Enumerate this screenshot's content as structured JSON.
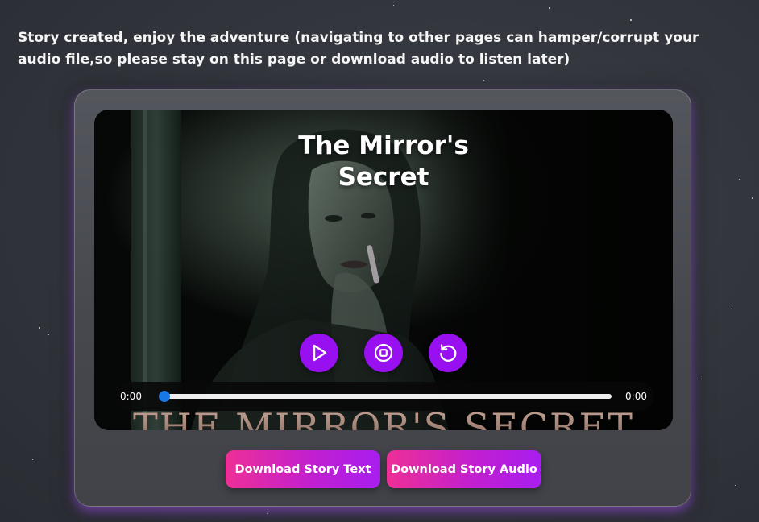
{
  "notice": {
    "text": "Story created, enjoy the adventure (navigating to other pages can hamper/corrupt your audio file,so please stay on this page or download audio to listen later)"
  },
  "story": {
    "title": "The Mirror's Secret",
    "cover_caption": "THE MIRROR'S SECRET"
  },
  "player": {
    "controls": [
      {
        "name": "play-button",
        "icon": "play-icon"
      },
      {
        "name": "stop-button",
        "icon": "stop-icon"
      },
      {
        "name": "restart-button",
        "icon": "restart-icon"
      }
    ],
    "current_time": "0:00",
    "duration": "0:00",
    "progress": 0
  },
  "actions": {
    "download_text_label": "Download Story Text",
    "download_audio_label": "Download Story Audio"
  },
  "colors": {
    "accent_purple": "#9810f0",
    "gradient_pink": "#ee2f96",
    "gradient_purple": "#a81ef0",
    "seek_thumb": "#1677e6"
  }
}
